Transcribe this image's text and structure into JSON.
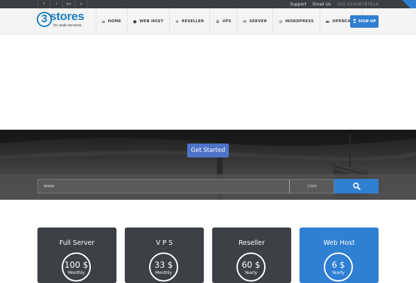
{
  "topbar": {
    "social_icons": [
      "facebook-icon",
      "twitter-icon",
      "google-plus-icon",
      "skype-icon"
    ],
    "social_glyphs": [
      "f",
      "t",
      "g+",
      "s"
    ],
    "links": [
      "Support",
      "Email Us"
    ],
    "phone": "002.01008787618"
  },
  "logo": {
    "digit": "3",
    "word": "stores",
    "tagline": "for arab services"
  },
  "nav": {
    "items": [
      {
        "label": "HOME",
        "icon": "home-icon",
        "glyph": "⌂"
      },
      {
        "label": "WEB HOST",
        "icon": "globe-icon",
        "glyph": "●"
      },
      {
        "label": "RESELLER",
        "icon": "share-icon",
        "glyph": "<"
      },
      {
        "label": "VPS",
        "icon": "sitemap-icon",
        "glyph": "≡"
      },
      {
        "label": "SERVER",
        "icon": "server-icon",
        "glyph": "✉"
      },
      {
        "label": "WORDPRESS",
        "icon": "wordpress-icon",
        "glyph": "◎"
      },
      {
        "label": "OPENCART",
        "icon": "cart-icon",
        "glyph": "▬"
      }
    ],
    "signup": "SIGN UP"
  },
  "hero": {
    "cta": "Get Started",
    "search": {
      "prefix": "www.",
      "tld": ".com"
    }
  },
  "plans": [
    {
      "name": "Full Server",
      "price": "100 $",
      "period": "Monthly",
      "active": false
    },
    {
      "name": "V P S",
      "price": "33 $",
      "period": "Monthly",
      "active": false
    },
    {
      "name": "Reseller",
      "price": "60 $",
      "period": "Yearly",
      "active": false
    },
    {
      "name": "Web Host",
      "price": "6 $",
      "period": "Yearly",
      "active": true
    }
  ],
  "colors": {
    "accent": "#2f7fd3",
    "cta": "#4e73c8",
    "dark": "#3d4045",
    "topbar": "#3a3d42"
  }
}
